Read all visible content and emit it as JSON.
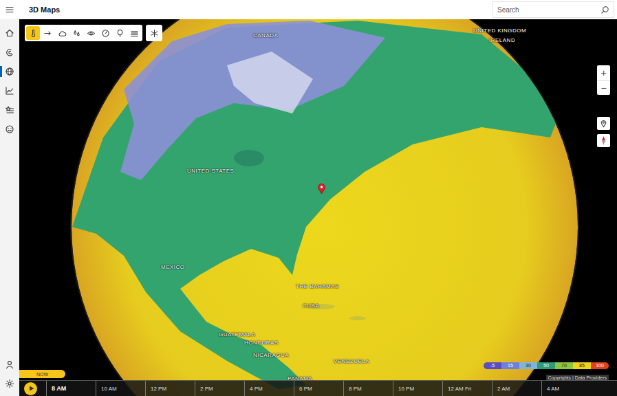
{
  "window": {
    "title": "3D Maps"
  },
  "search": {
    "placeholder": "Search"
  },
  "sidebar": {
    "items": [
      {
        "selected": false
      },
      {
        "selected": false
      },
      {
        "selected": true
      },
      {
        "selected": false
      },
      {
        "selected": false
      },
      {
        "selected": false
      }
    ],
    "bottom_items": [
      {
        "selected": false
      },
      {
        "selected": false
      }
    ]
  },
  "layers": {
    "items": [
      {
        "selected": true
      },
      {
        "selected": false
      },
      {
        "selected": false
      },
      {
        "selected": false
      },
      {
        "selected": false
      },
      {
        "selected": false
      },
      {
        "selected": false
      },
      {
        "selected": false
      }
    ],
    "snow": {
      "selected": false
    }
  },
  "map": {
    "labels": [
      "CANADA",
      "UNITED KINGDOM",
      "IRELAND",
      "UNITED STATES",
      "MEXICO",
      "THE BAHAMAS",
      "CUBA",
      "GUATEMALA",
      "HONDURAS",
      "NICARAGUA",
      "VENEZUELA",
      "PANAMA"
    ]
  },
  "zoom": {
    "in": "+",
    "out": "−"
  },
  "legend": {
    "stops": [
      {
        "label": "-5",
        "color": "#5a4cc4"
      },
      {
        "label": "15",
        "color": "#6f7fdc"
      },
      {
        "label": "30",
        "color": "#7fb5d8"
      },
      {
        "label": "50",
        "color": "#2f9c78"
      },
      {
        "label": "70",
        "color": "#8cc63e"
      },
      {
        "label": "85",
        "color": "#f0d21c"
      },
      {
        "label": "100",
        "color": "#e0401c"
      }
    ]
  },
  "attribution": "Copyrights | Data Providers",
  "timeline": {
    "now": "NOW",
    "times": [
      {
        "label": "8 AM",
        "selected": true
      },
      {
        "label": "10 AM",
        "selected": false
      },
      {
        "label": "12 PM",
        "selected": false
      },
      {
        "label": "2 PM",
        "selected": false
      },
      {
        "label": "4 PM",
        "selected": false
      },
      {
        "label": "6 PM",
        "selected": false
      },
      {
        "label": "8 PM",
        "selected": false
      },
      {
        "label": "10 PM",
        "selected": false
      },
      {
        "label": "12 AM Fri",
        "selected": false
      },
      {
        "label": "2 AM",
        "selected": false
      },
      {
        "label": "4 AM",
        "selected": false
      }
    ]
  }
}
